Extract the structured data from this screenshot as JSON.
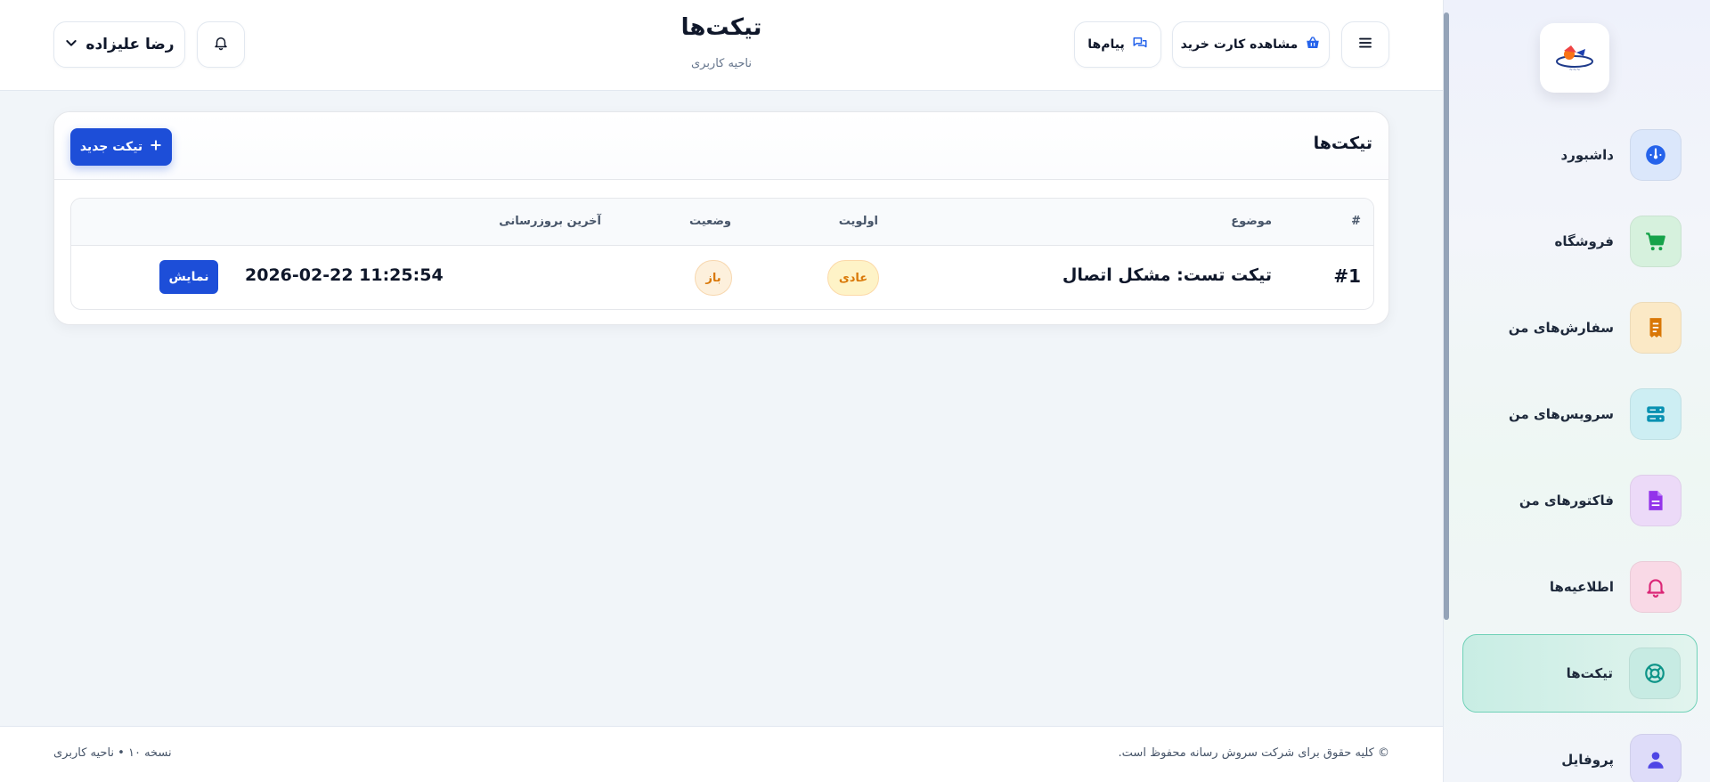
{
  "header": {
    "title": "تیکت‌ها",
    "subtitle": "ناحیه کاربری",
    "user_name": "رضا علیزاده",
    "messages_label": "پیام‌ها",
    "cart_label": "مشاهده کارت خرید"
  },
  "sidebar": {
    "items": [
      {
        "label": "داشبورد",
        "icon": "gauge-icon",
        "color": "#2563eb",
        "bg": "#dbe7fb"
      },
      {
        "label": "فروشگاه",
        "icon": "cart-icon",
        "color": "#16a34a",
        "bg": "#d6f1dd"
      },
      {
        "label": "سفارش‌های من",
        "icon": "receipt-icon",
        "color": "#d97706",
        "bg": "#fbe9c6"
      },
      {
        "label": "سرویس‌های من",
        "icon": "server-icon",
        "color": "#0891b2",
        "bg": "#cdeef3"
      },
      {
        "label": "فاکتورهای من",
        "icon": "invoice-icon",
        "color": "#9333ea",
        "bg": "#ecdaf8"
      },
      {
        "label": "اطلاعیه‌ها",
        "icon": "bell-icon",
        "color": "#db2777",
        "bg": "#f9d9e6"
      },
      {
        "label": "تیکت‌ها",
        "icon": "lifebuoy-icon",
        "color": "#0d9488",
        "bg": "#c7ebe3"
      },
      {
        "label": "پروفایل",
        "icon": "user-icon",
        "color": "#4f46e5",
        "bg": "#dedcf9"
      }
    ]
  },
  "card": {
    "title": "تیکت‌ها",
    "new_button_label": "تیکت جدید",
    "columns": {
      "number": "#",
      "subject": "موضوع",
      "priority": "اولویت",
      "status": "وضعیت",
      "updated": "آخرین بروزرسانی"
    },
    "rows": [
      {
        "number": "#1",
        "subject": "تیکت تست: مشکل اتصال",
        "priority": "عادی",
        "status": "باز",
        "updated": "2026-02-22 11:25:54",
        "action": "نمایش"
      }
    ]
  },
  "footer": {
    "copyright": "© کلیه حقوق برای شرکت سروش رسانه محفوظ است.",
    "version": "نسخه ۱۰ • ناحیه کاربری"
  },
  "colors": {
    "accent": "#1d4ed8",
    "priority_badge_bg": "#fef3c7",
    "priority_badge_text": "#d97706",
    "status_badge_bg": "#fdf0dc",
    "status_badge_text": "#d97706",
    "active_nav_border": "#6fd1b7"
  }
}
